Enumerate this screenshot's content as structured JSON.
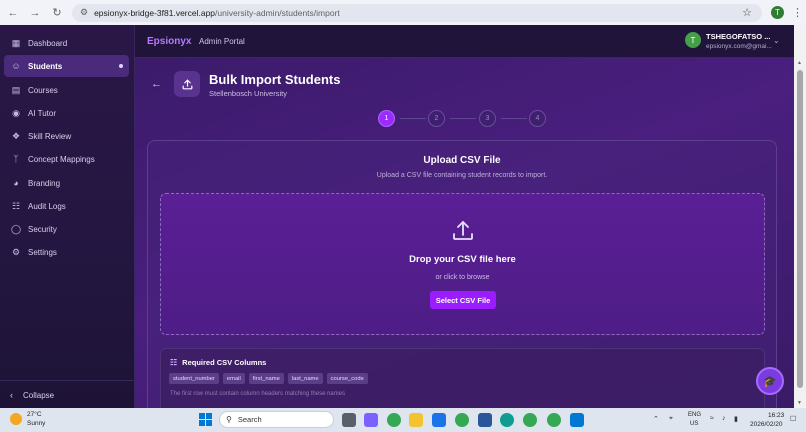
{
  "browser": {
    "url_host": "epsionyx-bridge-3f81.vercel.app",
    "url_path": "/university-admin/students/import",
    "profile_initial": "T"
  },
  "header": {
    "brand": "Epsionyx",
    "portal": "Admin Portal",
    "user_initial": "T",
    "user_name": "TSHEGOFATSO ...",
    "user_email": "epsionyx.com@gmai..."
  },
  "sidebar": {
    "items": [
      {
        "label": "Dashboard",
        "icon": "grid-icon"
      },
      {
        "label": "Students",
        "icon": "users-icon"
      },
      {
        "label": "Courses",
        "icon": "book-icon"
      },
      {
        "label": "AI Tutor",
        "icon": "tutor-icon"
      },
      {
        "label": "Skill Review",
        "icon": "puzzle-icon"
      },
      {
        "label": "Concept Mappings",
        "icon": "branch-icon"
      },
      {
        "label": "Branding",
        "icon": "palette-icon"
      },
      {
        "label": "Audit Logs",
        "icon": "document-icon"
      },
      {
        "label": "Security",
        "icon": "shield-icon"
      },
      {
        "label": "Settings",
        "icon": "gear-icon"
      }
    ],
    "collapse_label": "Collapse"
  },
  "page": {
    "title": "Bulk Import Students",
    "subtitle": "Stellenbosch University"
  },
  "steps": [
    "1",
    "2",
    "3",
    "4"
  ],
  "upload": {
    "title": "Upload CSV File",
    "subtitle": "Upload a CSV file containing student records to import.",
    "drop_title": "Drop your CSV file here",
    "drop_sub": "or click to browse",
    "button": "Select CSV File"
  },
  "required": {
    "title": "Required CSV Columns",
    "columns": [
      "student_number",
      "email",
      "first_name",
      "last_name",
      "course_code"
    ],
    "note": "The first row must contain column headers matching these names"
  },
  "taskbar": {
    "temp": "27°C",
    "weather": "Sunny",
    "search": "Search",
    "lang1": "ENG",
    "lang2": "US",
    "time": "16:23",
    "date": "2026/02/20"
  },
  "colors": {
    "accent": "#9b1cff",
    "brand": "#b57aff",
    "sidebar_bg": "#2a1747"
  }
}
